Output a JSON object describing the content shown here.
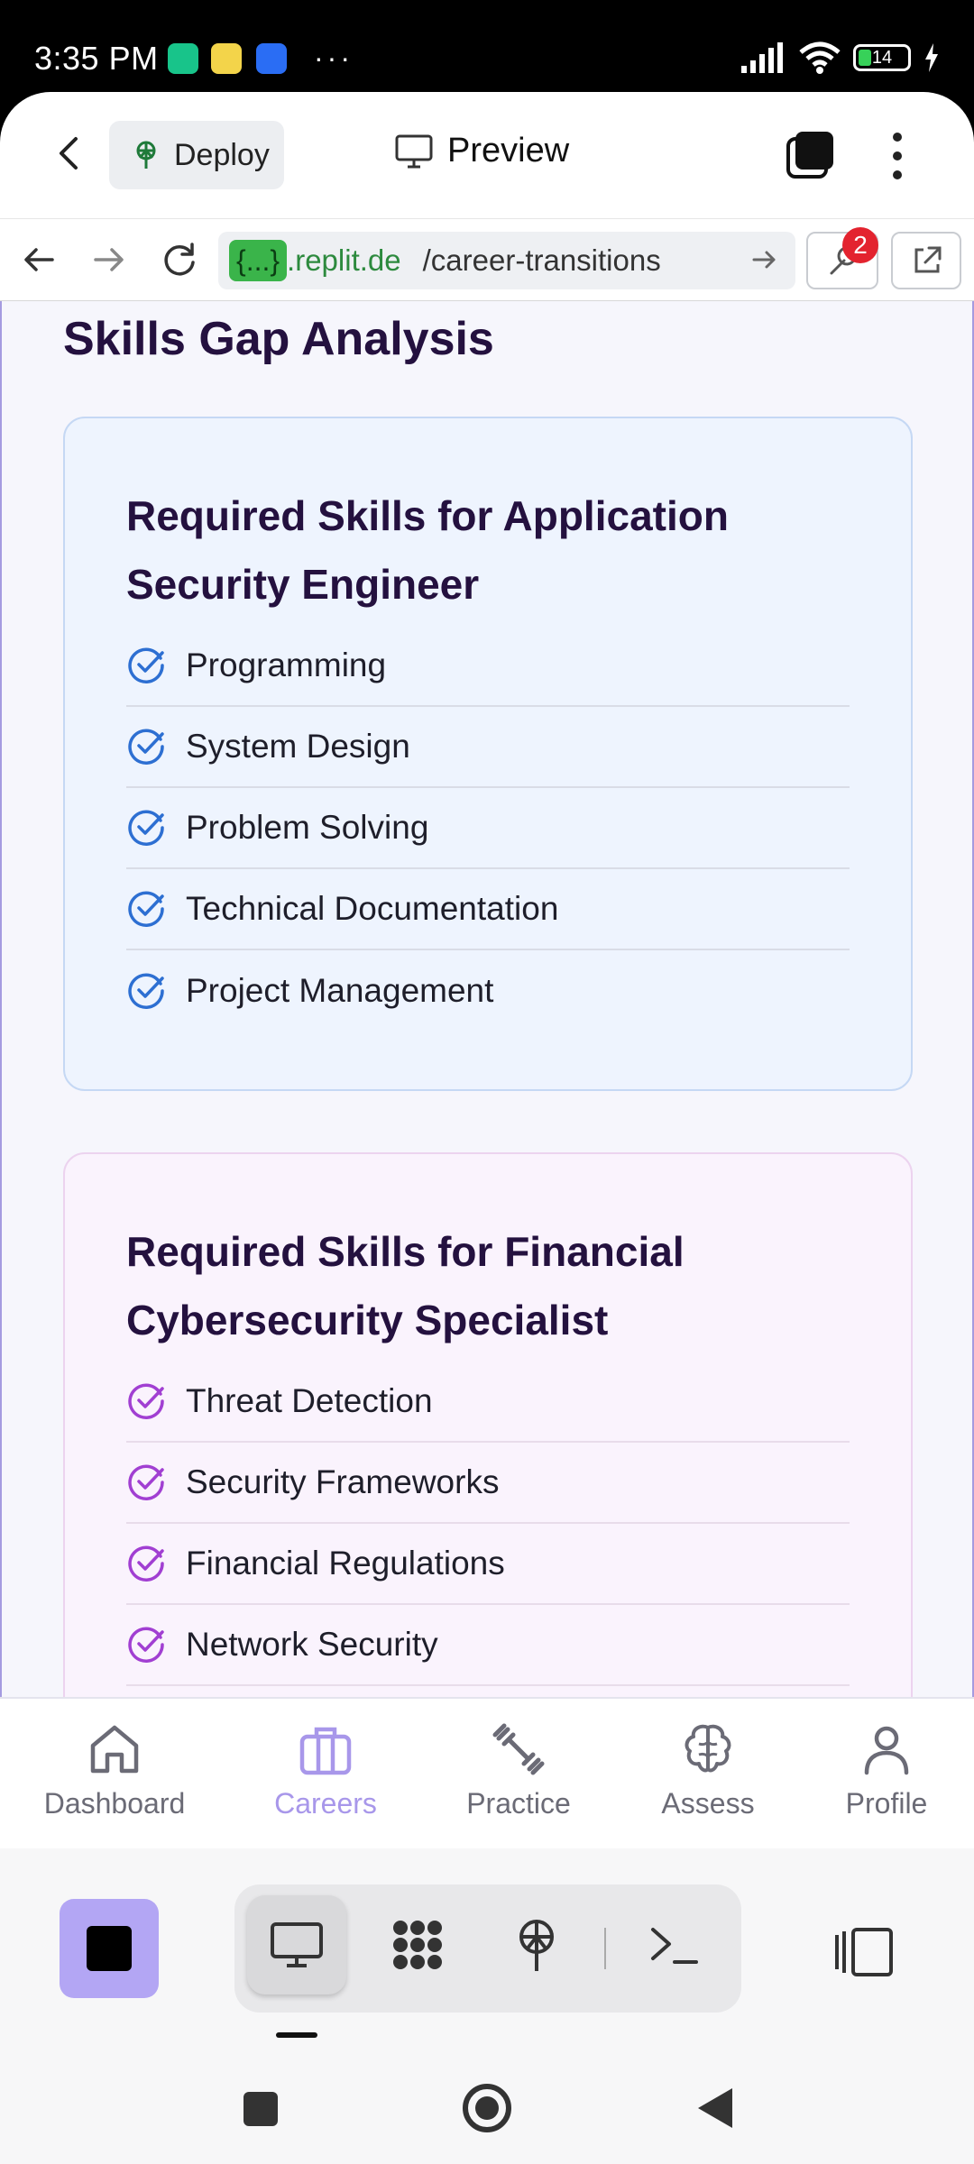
{
  "status_bar": {
    "time": "3:35 PM",
    "more": "···",
    "battery": "14"
  },
  "header": {
    "deploy_label": "Deploy",
    "title": "Preview"
  },
  "browser": {
    "url_badge": "{...}",
    "url_host": ".replit.de",
    "url_path": "/career-transitions",
    "devtools_badge": "2"
  },
  "page": {
    "section_title": "Skills Gap Analysis",
    "cards": [
      {
        "title": "Required Skills for Application Security Engineer",
        "accent": "#2d6fd2",
        "skills": [
          "Programming",
          "System Design",
          "Problem Solving",
          "Technical Documentation",
          "Project Management"
        ]
      },
      {
        "title": "Required Skills for Financial Cybersecurity Specialist",
        "accent": "#a13fd2",
        "skills": [
          "Threat Detection",
          "Security Frameworks",
          "Financial Regulations",
          "Network Security"
        ]
      }
    ]
  },
  "bottom_nav": {
    "items": [
      {
        "label": "Dashboard",
        "icon": "home-icon"
      },
      {
        "label": "Careers",
        "icon": "briefcase-icon",
        "active": true
      },
      {
        "label": "Practice",
        "icon": "dumbbell-icon"
      },
      {
        "label": "Assess",
        "icon": "brain-icon"
      },
      {
        "label": "Profile",
        "icon": "user-icon"
      }
    ],
    "active_color": "#a897ea"
  }
}
